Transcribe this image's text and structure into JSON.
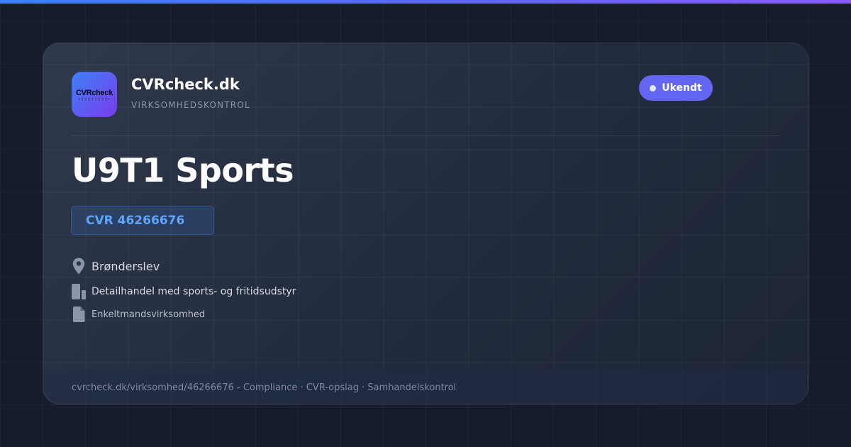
{
  "brand": {
    "logo_text": "CVRcheck",
    "name": "CVRcheck.dk",
    "tagline": "VIRKSOMHEDSKONTROL"
  },
  "status": {
    "label": "Ukendt",
    "color": "#6366f1"
  },
  "company": {
    "name": "U9T1 Sports",
    "cvr": "CVR 46266676",
    "location": "Brønderslev",
    "industry": "Detailhandel med sports- og fritidsudstyr",
    "company_type": "Enkeltmandsvirksomhed"
  },
  "icons": {
    "location": "map-pin-icon",
    "industry": "building-icon",
    "company_type": "document-icon"
  },
  "footer": {
    "text": "cvrcheck.dk/virksomhed/46266676 - Compliance · CVR-opslag · Samhandelskontrol"
  },
  "colors": {
    "accent_blue": "#3b82f6",
    "accent_purple": "#7c3aed",
    "cvr_text": "#60a5fa",
    "background": "#151d2d"
  }
}
